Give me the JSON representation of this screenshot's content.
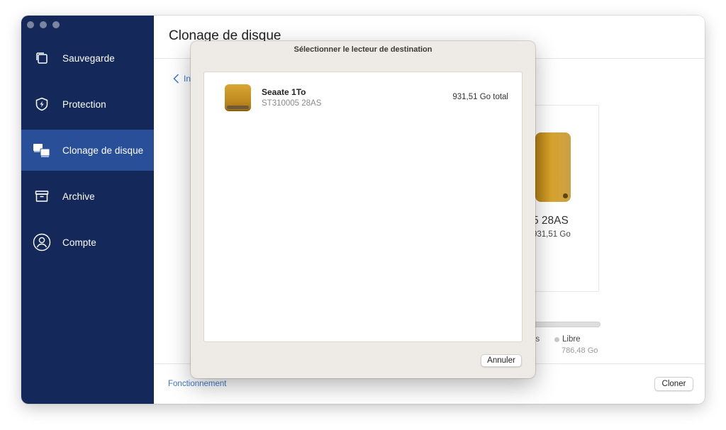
{
  "sidebar": {
    "items": [
      {
        "label": "Sauvegarde",
        "icon": "copy-icon",
        "active": false
      },
      {
        "label": "Protection",
        "icon": "shield-bolt-icon",
        "active": false
      },
      {
        "label": "Clonage de disque",
        "icon": "disk-clone-icon",
        "active": true
      },
      {
        "label": "Archive",
        "icon": "archive-box-icon",
        "active": false
      },
      {
        "label": "Compte",
        "icon": "user-circle-icon",
        "active": false
      }
    ]
  },
  "main": {
    "title": "Clonage de disque",
    "back_label": "In",
    "card": {
      "drive_name_partial": "5 28AS",
      "drive_size_partial": "931,51 Go",
      "legend_partial": "es",
      "free_label": "Libre",
      "free_value": "786,48 Go"
    },
    "footer": {
      "link_label": "Fonctionnement",
      "clone_button": "Cloner"
    }
  },
  "dialog": {
    "title": "Sélectionner le lecteur de destination",
    "drives": [
      {
        "name": "Seaate 1To",
        "model": "ST310005 28AS",
        "total": "931,51 Go total"
      }
    ],
    "cancel_button": "Annuler"
  },
  "colors": {
    "sidebar_bg": "#14295a",
    "sidebar_active": "#2a4f99",
    "link": "#3a78c9",
    "drive_gold": "#d9a52c",
    "dialog_bg": "#eeeae5"
  }
}
